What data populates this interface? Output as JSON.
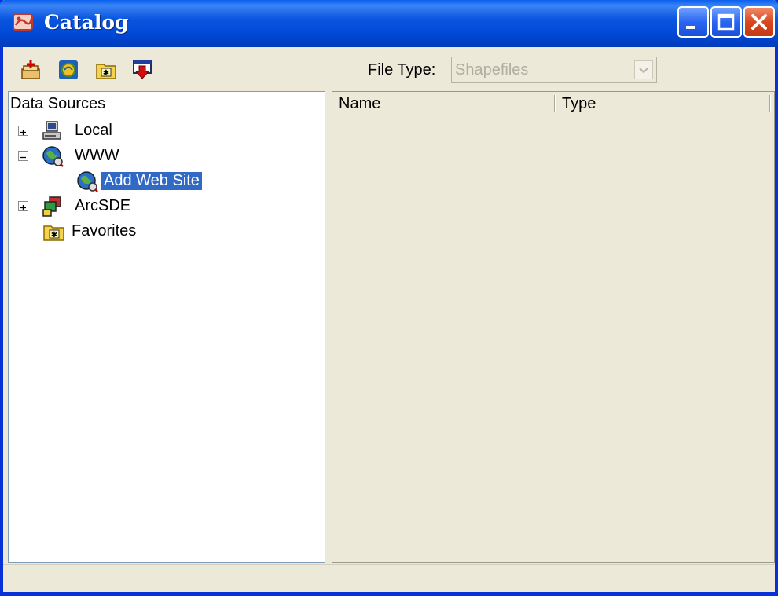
{
  "window": {
    "title": "Catalog",
    "icon": "catalog-app-icon",
    "controls": {
      "minimize": "minimize-icon",
      "maximize": "maximize-icon",
      "close": "close-icon"
    }
  },
  "toolbar": {
    "buttons": [
      {
        "icon": "add-data-source-icon"
      },
      {
        "icon": "web-connect-icon"
      },
      {
        "icon": "favorites-folder-icon"
      },
      {
        "icon": "download-icon"
      }
    ],
    "file_type_label": "File Type:",
    "file_type_value": "Shapefiles"
  },
  "tree": {
    "root_label": "Data Sources",
    "nodes": [
      {
        "label": "Local",
        "icon": "computer-icon",
        "expander": "+"
      },
      {
        "label": "WWW",
        "icon": "globe-icon",
        "expander": "-"
      },
      {
        "label": "Add Web Site",
        "icon": "globe-icon",
        "selected": true
      },
      {
        "label": "ArcSDE",
        "icon": "database-server-icon",
        "expander": "+"
      },
      {
        "label": "Favorites",
        "icon": "favorites-folder-icon"
      }
    ]
  },
  "list": {
    "columns": [
      "Name",
      "Type"
    ]
  },
  "colors": {
    "titlebar": "#0054e3",
    "selection": "#316ac5",
    "panel": "#ece9d8"
  }
}
